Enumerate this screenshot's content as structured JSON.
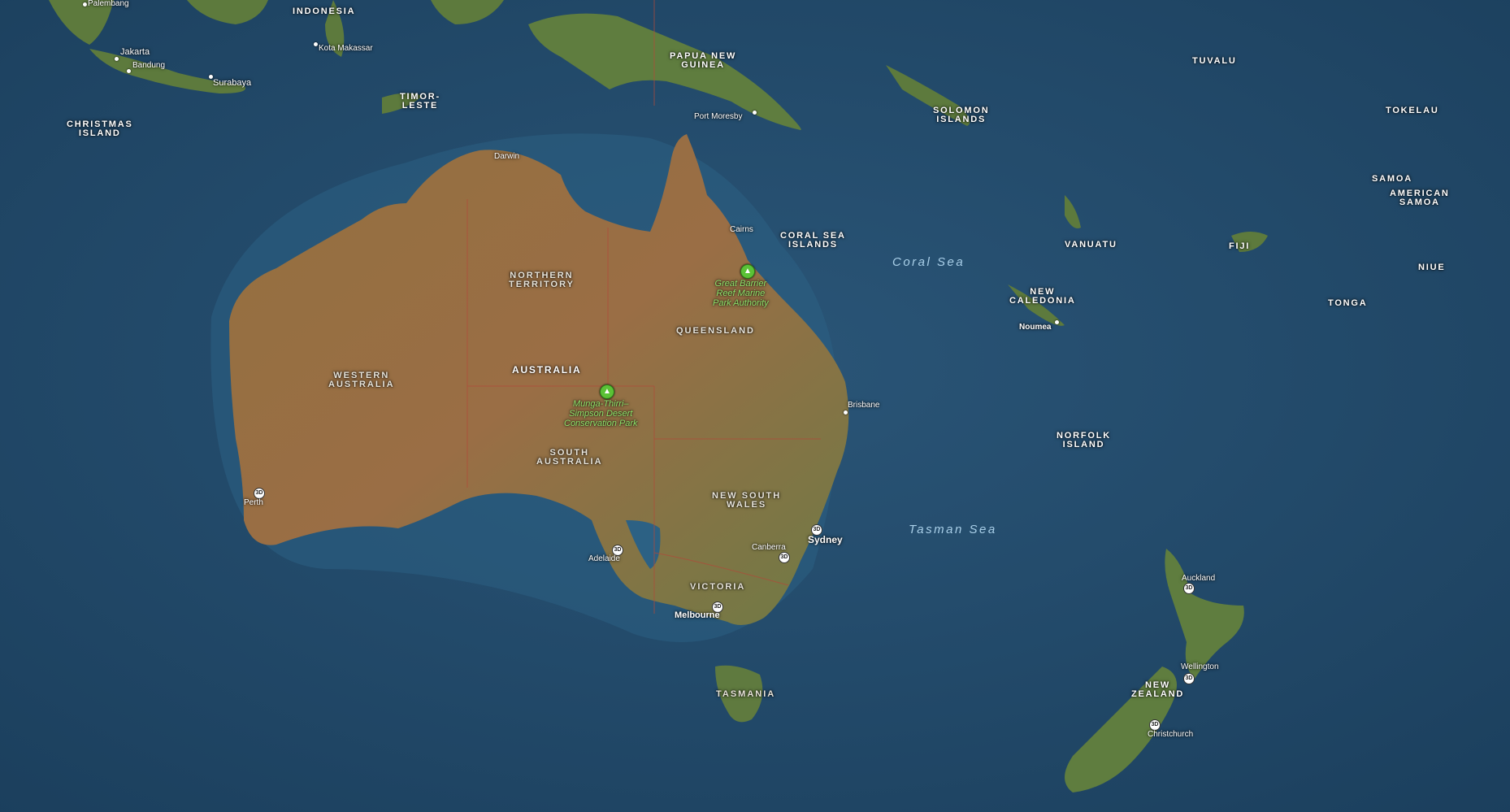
{
  "map": {
    "colors": {
      "ocean": "#1f4766",
      "land": "#8a6b42",
      "vegetation": "#4f7a3a",
      "park": "#5bc236"
    },
    "badge_text": "3D",
    "countries": {
      "indonesia": "INDONESIA",
      "png": "PAPUA NEW\nGUINEA",
      "timor": "TIMOR-\nLESTE",
      "christmas": "CHRISTMAS\nISLAND",
      "solomon": "SOLOMON\nISLANDS",
      "tuvalu": "TUVALU",
      "tokelau": "TOKELAU",
      "samoa": "SAMOA",
      "american_samoa": "AMERICAN\nSAMOA",
      "vanuatu": "VANUATU",
      "fiji": "FIJI",
      "niue": "NIUE",
      "tonga": "TONGA",
      "new_caledonia": "NEW\nCALEDONIA",
      "norfolk": "NORFOLK\nISLAND",
      "coral_sea_islands": "CORAL SEA\nISLANDS",
      "australia": "AUSTRALIA",
      "new_zealand": "NEW\nZEALAND"
    },
    "regions": {
      "nt": "NORTHERN\nTERRITORY",
      "wa": "WESTERN\nAUSTRALIA",
      "qld": "QUEENSLAND",
      "sa": "SOUTH\nAUSTRALIA",
      "nsw": "NEW SOUTH\nWALES",
      "vic": "VICTORIA",
      "tas": "TASMANIA"
    },
    "seas": {
      "coral": "Coral Sea",
      "tasman": "Tasman Sea"
    },
    "cities": {
      "palembang": "Palembang",
      "jakarta": "Jakarta",
      "bandung": "Bandung",
      "surabaya": "Surabaya",
      "makassar": "Kota Makassar",
      "port_moresby": "Port Moresby",
      "darwin": "Darwin",
      "cairns": "Cairns",
      "brisbane": "Brisbane",
      "sydney": "Sydney",
      "canberra": "Canberra",
      "melbourne": "Melbourne",
      "adelaide": "Adelaide",
      "perth": "Perth",
      "noumea": "Noumea",
      "auckland": "Auckland",
      "wellington": "Wellington",
      "christchurch": "Christchurch"
    },
    "parks": {
      "gbr": "Great Barrier\nReef Marine\nPark Authority",
      "munga": "Munga-Thirri–\nSimpson Desert\nConservation Park"
    }
  }
}
